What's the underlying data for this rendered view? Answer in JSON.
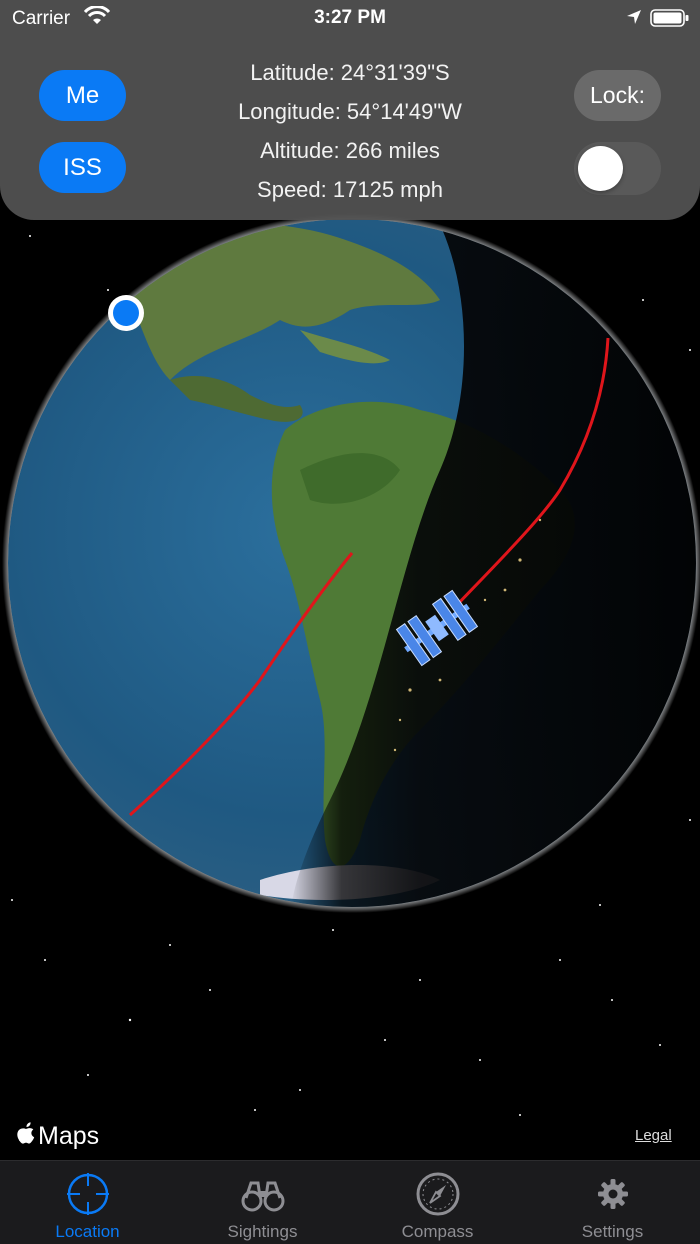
{
  "status_bar": {
    "carrier": "Carrier",
    "time": "3:27 PM"
  },
  "panel": {
    "me_button": "Me",
    "iss_button": "ISS",
    "latitude": "Latitude: 24°31'39\"S",
    "longitude": "Longitude: 54°14'49\"W",
    "altitude": "Altitude: 266 miles",
    "speed": "Speed: 17125 mph",
    "lock_label": "Lock:",
    "lock_enabled": false
  },
  "map": {
    "attribution": "Maps",
    "legal_link": "Legal",
    "orbit_color": "#e0151b",
    "user_dot_color": "#0a7af5"
  },
  "tabs": [
    {
      "label": "Location",
      "icon": "crosshair-icon",
      "active": true
    },
    {
      "label": "Sightings",
      "icon": "binoculars-icon",
      "active": false
    },
    {
      "label": "Compass",
      "icon": "compass-icon",
      "active": false
    },
    {
      "label": "Settings",
      "icon": "gear-icon",
      "active": false
    }
  ],
  "colors": {
    "accent": "#0a7af5",
    "panel_bg": "#525252",
    "tabbar_bg": "#1b1b1d",
    "inactive_tab": "#8e8e93"
  }
}
